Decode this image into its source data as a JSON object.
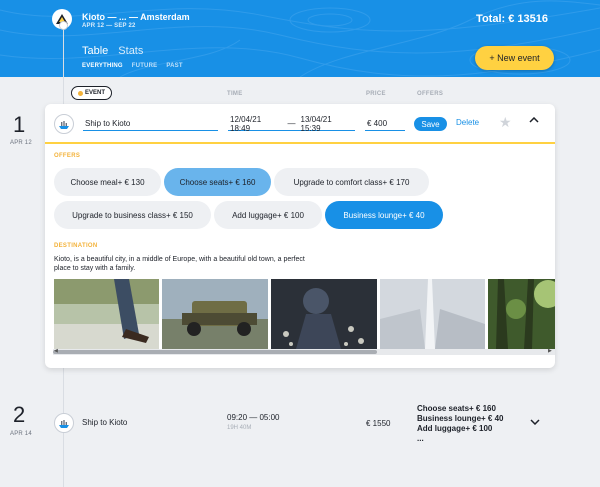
{
  "header": {
    "route": "Kioto — ... — Amsterdam",
    "dates": "APR 12 — SEP 22",
    "total": "Total: € 13516",
    "tabs": [
      "Table",
      "Stats"
    ],
    "filters": [
      "EVERYTHING",
      "FUTURE",
      "PAST"
    ],
    "new_event_label": "+ New event",
    "color_brand": "#1890e6",
    "color_accent": "#ffd141"
  },
  "columns": {
    "event": "EVENT",
    "time": "TIME",
    "price": "PRICE",
    "offers": "OFFERS"
  },
  "days": [
    {
      "num": "1",
      "date": "APR 12"
    },
    {
      "num": "2",
      "date": "APR 14"
    }
  ],
  "editing_event": {
    "destination_value": "Ship to Kioto",
    "time_from": "12/04/21 18:49",
    "time_sep": "—",
    "time_to": "13/04/21 15:39",
    "price": "€ 400",
    "save_label": "Save",
    "delete_label": "Delete",
    "offers_title": "OFFERS",
    "offers": [
      "Choose meal+ € 130",
      "Choose seats+ € 160",
      "Upgrade to comfort class+ € 170",
      "Upgrade to business class+ € 150",
      "Add luggage+ € 100",
      "Business lounge+ € 40"
    ],
    "destination_title": "DESTINATION",
    "description": "Kioto, is a beautiful city, in a middle of Europe, with a beautiful old town, a perfect place to stay with a family."
  },
  "event_row": {
    "name": "Ship to Kioto",
    "time": "09:20 — 05:00",
    "duration": "19H 40M",
    "price": "€ 1550",
    "offers": [
      "Choose seats+ € 160",
      "Business lounge+ € 40",
      "Add luggage+ € 100",
      "..."
    ]
  }
}
